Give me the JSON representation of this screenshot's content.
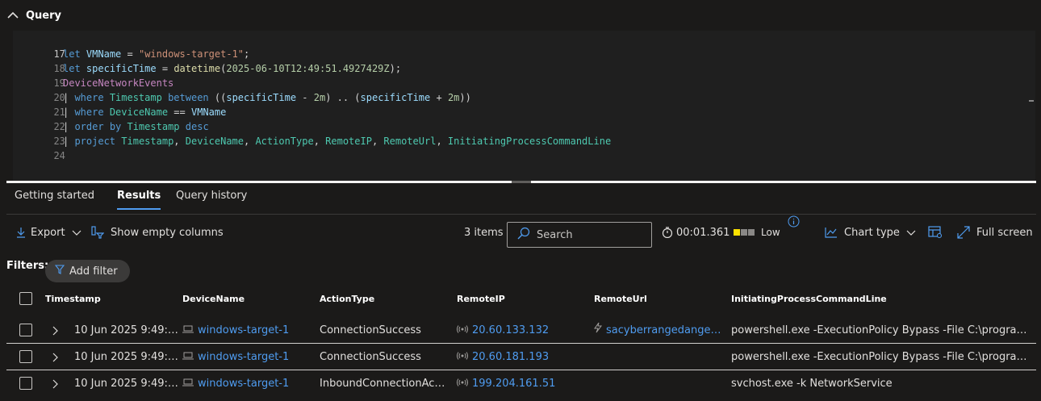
{
  "query_panel": {
    "title": "Query"
  },
  "editor": {
    "lines": [
      {
        "number": "17",
        "text": ""
      },
      {
        "number": "18",
        "text": "let VMName = \"windows-target-1\";"
      },
      {
        "number": "19",
        "text": "let specificTime = datetime(2025-06-10T12:49:51.4927429Z);"
      },
      {
        "number": "20",
        "text": "DeviceNetworkEvents"
      },
      {
        "number": "21",
        "text": "| where Timestamp between ((specificTime - 2m) .. (specificTime + 2m))"
      },
      {
        "number": "22",
        "text": "| where DeviceName == VMName"
      },
      {
        "number": "23",
        "text": "| order by Timestamp desc"
      },
      {
        "number": "24",
        "text": "| project Timestamp, DeviceName, ActionType, RemoteIP, RemoteUrl, InitiatingProcessCommandLine"
      }
    ]
  },
  "tabs": [
    {
      "label": "Getting started",
      "active": false
    },
    {
      "label": "Results",
      "active": true
    },
    {
      "label": "Query history",
      "active": false
    }
  ],
  "toolbar": {
    "export_label": "Export",
    "show_empty_label": "Show empty columns",
    "items_count": "3 items",
    "search_placeholder": "Search",
    "elapsed": "00:01.361",
    "severity_label": "Low",
    "chart_type_label": "Chart type",
    "full_screen_label": "Full screen"
  },
  "filters": {
    "label": "Filters:",
    "add_filter_label": "Add filter"
  },
  "table": {
    "columns": [
      "Timestamp",
      "DeviceName",
      "ActionType",
      "RemoteIP",
      "RemoteUrl",
      "InitiatingProcessCommandLine"
    ],
    "rows": [
      {
        "timestamp": "10 Jun 2025 9:49:5...",
        "device": "windows-target-1",
        "action": "ConnectionSuccess",
        "remote_ip": "20.60.133.132",
        "remote_url": "sacyberrangedanger....",
        "cmdline": "powershell.exe -ExecutionPolicy Bypass -File C:\\program..."
      },
      {
        "timestamp": "10 Jun 2025 9:49:4...",
        "device": "windows-target-1",
        "action": "ConnectionSuccess",
        "remote_ip": "20.60.181.193",
        "remote_url": "",
        "cmdline": "powershell.exe -ExecutionPolicy Bypass -File C:\\program..."
      },
      {
        "timestamp": "10 Jun 2025 9:49:2...",
        "device": "windows-target-1",
        "action": "InboundConnectionAcc...",
        "remote_ip": "199.204.161.51",
        "remote_url": "",
        "cmdline": "svchost.exe -k NetworkService"
      }
    ]
  },
  "colors": {
    "accent": "#4f9cf0",
    "background": "#1b1a19",
    "editor_bg": "#1f1f1f",
    "severity_low": "#fce100"
  }
}
